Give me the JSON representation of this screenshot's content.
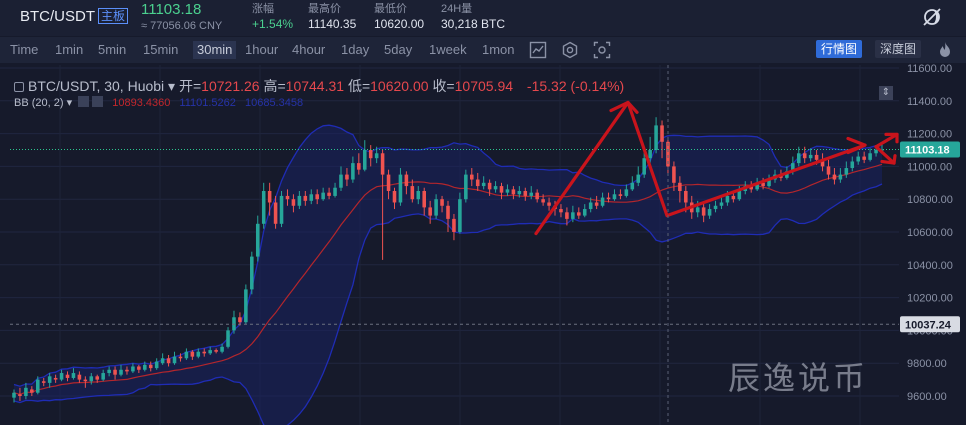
{
  "header": {
    "pair": "BTC/USDT",
    "main_tag": "主板",
    "price": "11103.18",
    "cny": "≈ 77056.06 CNY",
    "stats": [
      {
        "label": "涨幅",
        "value": "+1.54%",
        "up": true
      },
      {
        "label": "最高价",
        "value": "11140.35",
        "up": false
      },
      {
        "label": "最低价",
        "value": "10620.00",
        "up": false
      },
      {
        "label": "24H量",
        "value": "30,218 BTC",
        "up": false
      }
    ],
    "logo_icon": "moon-slash-icon"
  },
  "timeframes": {
    "items": [
      "Time",
      "1min",
      "5min",
      "15min",
      "30min",
      "1hour",
      "4hour",
      "1day",
      "5day",
      "1week",
      "1mon"
    ],
    "active": "30min"
  },
  "tools": {
    "icons": [
      "indicator-icon",
      "settings-hex-icon",
      "screenshot-icon"
    ],
    "views": [
      "行情图",
      "深度图"
    ],
    "active_view": "行情图",
    "flame_icon": "flame-icon"
  },
  "legend": {
    "title": "BTC/USDT, 30, Huobi",
    "open_label": "开=",
    "open": "10721.26",
    "high_label": "高=",
    "high": "10744.31",
    "low_label": "低=",
    "low": "10620.00",
    "close_label": "收=",
    "close": "10705.94",
    "change": "-15.32 (-0.14%)"
  },
  "bb": {
    "label": "BB (20, 2)",
    "mid": "10893.4360",
    "upper": "11101.5262",
    "lower": "10685.3458"
  },
  "axis": {
    "ticks": [
      "11600.00",
      "11400.00",
      "11200.00",
      "11000.00",
      "10800.00",
      "10600.00",
      "10400.00",
      "10200.00",
      "10000.00",
      "9800.00",
      "9600.00"
    ],
    "current_price": "11103.18",
    "marker_price": "10037.24"
  },
  "watermark": "辰逸说币",
  "colors": {
    "up": "#26a69a",
    "down": "#ef5350",
    "accent": "#2f6bd8",
    "band_upper": "#1f2cb5",
    "band_mid": "#b3262c",
    "arrow": "#c9141c"
  },
  "chart_data": {
    "type": "candlestick",
    "y_range": [
      9520,
      11700
    ],
    "candles": [
      [
        9590,
        9620,
        9560,
        9640
      ],
      [
        9610,
        9600,
        9570,
        9650
      ],
      [
        9600,
        9650,
        9580,
        9680
      ],
      [
        9640,
        9620,
        9600,
        9660
      ],
      [
        9620,
        9700,
        9610,
        9720
      ],
      [
        9690,
        9680,
        9660,
        9710
      ],
      [
        9680,
        9720,
        9650,
        9740
      ],
      [
        9710,
        9700,
        9680,
        9730
      ],
      [
        9700,
        9740,
        9690,
        9760
      ],
      [
        9730,
        9710,
        9690,
        9750
      ],
      [
        9710,
        9740,
        9700,
        9770
      ],
      [
        9730,
        9700,
        9680,
        9750
      ],
      [
        9700,
        9690,
        9650,
        9720
      ],
      [
        9690,
        9720,
        9670,
        9740
      ],
      [
        9720,
        9700,
        9680,
        9730
      ],
      [
        9700,
        9740,
        9690,
        9760
      ],
      [
        9740,
        9760,
        9720,
        9780
      ],
      [
        9760,
        9730,
        9700,
        9780
      ],
      [
        9730,
        9760,
        9720,
        9790
      ],
      [
        9760,
        9750,
        9730,
        9780
      ],
      [
        9750,
        9780,
        9740,
        9800
      ],
      [
        9780,
        9760,
        9740,
        9790
      ],
      [
        9760,
        9790,
        9750,
        9810
      ],
      [
        9790,
        9770,
        9750,
        9810
      ],
      [
        9770,
        9810,
        9760,
        9830
      ],
      [
        9800,
        9830,
        9790,
        9860
      ],
      [
        9830,
        9800,
        9780,
        9850
      ],
      [
        9800,
        9840,
        9790,
        9870
      ],
      [
        9840,
        9830,
        9810,
        9860
      ],
      [
        9830,
        9870,
        9820,
        9890
      ],
      [
        9870,
        9840,
        9820,
        9880
      ],
      [
        9840,
        9870,
        9830,
        9890
      ],
      [
        9870,
        9860,
        9840,
        9890
      ],
      [
        9860,
        9880,
        9850,
        9900
      ],
      [
        9880,
        9870,
        9860,
        9890
      ],
      [
        9870,
        9900,
        9860,
        9920
      ],
      [
        9900,
        10000,
        9890,
        10020
      ],
      [
        10000,
        10080,
        9980,
        10120
      ],
      [
        10080,
        10050,
        10030,
        10110
      ],
      [
        10050,
        10250,
        10040,
        10280
      ],
      [
        10250,
        10450,
        10220,
        10480
      ],
      [
        10450,
        10650,
        10420,
        10700
      ],
      [
        10650,
        10850,
        10620,
        10900
      ],
      [
        10850,
        10780,
        10700,
        10900
      ],
      [
        10780,
        10650,
        10620,
        10820
      ],
      [
        10650,
        10820,
        10630,
        10850
      ],
      [
        10820,
        10800,
        10760,
        10860
      ],
      [
        10800,
        10760,
        10720,
        10830
      ],
      [
        10760,
        10820,
        10740,
        10850
      ],
      [
        10820,
        10790,
        10760,
        10850
      ],
      [
        10790,
        10830,
        10770,
        10860
      ],
      [
        10830,
        10800,
        10770,
        10860
      ],
      [
        10800,
        10840,
        10790,
        10870
      ],
      [
        10840,
        10820,
        10800,
        10870
      ],
      [
        10820,
        10870,
        10810,
        10900
      ],
      [
        10870,
        10950,
        10850,
        11000
      ],
      [
        10950,
        10920,
        10880,
        10990
      ],
      [
        10920,
        11020,
        10900,
        11060
      ],
      [
        11020,
        10980,
        10950,
        11080
      ],
      [
        10980,
        11100,
        10970,
        11160
      ],
      [
        11100,
        11050,
        11000,
        11130
      ],
      [
        11050,
        11080,
        11020,
        11120
      ],
      [
        11080,
        10950,
        10430,
        11100
      ],
      [
        10950,
        10850,
        10800,
        10980
      ],
      [
        10850,
        10780,
        10740,
        10870
      ],
      [
        10780,
        10950,
        10760,
        10990
      ],
      [
        10950,
        10880,
        10830,
        10970
      ],
      [
        10880,
        10800,
        10780,
        10920
      ],
      [
        10800,
        10850,
        10770,
        10880
      ],
      [
        10850,
        10750,
        10700,
        10870
      ],
      [
        10750,
        10700,
        10650,
        10790
      ],
      [
        10700,
        10800,
        10680,
        10830
      ],
      [
        10800,
        10760,
        10720,
        10820
      ],
      [
        10760,
        10680,
        10600,
        10790
      ],
      [
        10680,
        10600,
        10550,
        10710
      ],
      [
        10600,
        10800,
        10590,
        10840
      ],
      [
        10800,
        10950,
        10780,
        10980
      ],
      [
        10950,
        10920,
        10880,
        10990
      ],
      [
        10920,
        10880,
        10850,
        10960
      ],
      [
        10880,
        10900,
        10860,
        10940
      ],
      [
        10900,
        10860,
        10820,
        10920
      ],
      [
        10860,
        10880,
        10840,
        10910
      ],
      [
        10880,
        10840,
        10800,
        10900
      ],
      [
        10840,
        10860,
        10820,
        10890
      ],
      [
        10860,
        10830,
        10800,
        10880
      ],
      [
        10830,
        10850,
        10810,
        10880
      ],
      [
        10850,
        10820,
        10790,
        10870
      ],
      [
        10820,
        10840,
        10800,
        10880
      ],
      [
        10840,
        10800,
        10780,
        10860
      ],
      [
        10800,
        10780,
        10760,
        10830
      ],
      [
        10780,
        10760,
        10730,
        10810
      ],
      [
        10760,
        10740,
        10700,
        10790
      ],
      [
        10740,
        10720,
        10690,
        10770
      ],
      [
        10720,
        10680,
        10640,
        10750
      ],
      [
        10680,
        10720,
        10660,
        10760
      ],
      [
        10720,
        10700,
        10680,
        10750
      ],
      [
        10700,
        10740,
        10690,
        10770
      ],
      [
        10740,
        10780,
        10720,
        10810
      ],
      [
        10780,
        10760,
        10740,
        10820
      ],
      [
        10760,
        10810,
        10750,
        10840
      ],
      [
        10810,
        10800,
        10780,
        10840
      ],
      [
        10800,
        10830,
        10790,
        10860
      ],
      [
        10830,
        10820,
        10800,
        10860
      ],
      [
        10820,
        10860,
        10810,
        10890
      ],
      [
        10860,
        10900,
        10850,
        10940
      ],
      [
        10900,
        10950,
        10880,
        11000
      ],
      [
        10950,
        11050,
        10930,
        11100
      ],
      [
        11050,
        11100,
        11020,
        11180
      ],
      [
        11100,
        11250,
        11080,
        11300
      ],
      [
        11250,
        11150,
        11050,
        11280
      ],
      [
        11150,
        11000,
        10950,
        11180
      ],
      [
        11000,
        10900,
        10850,
        11030
      ],
      [
        10900,
        10850,
        10780,
        10940
      ],
      [
        10850,
        10780,
        10720,
        10880
      ],
      [
        10780,
        10720,
        10680,
        10820
      ],
      [
        10720,
        10750,
        10690,
        10790
      ],
      [
        10750,
        10700,
        10660,
        10780
      ],
      [
        10700,
        10740,
        10680,
        10770
      ],
      [
        10740,
        10760,
        10720,
        10790
      ],
      [
        10760,
        10780,
        10740,
        10820
      ],
      [
        10780,
        10820,
        10760,
        10850
      ],
      [
        10820,
        10800,
        10780,
        10850
      ],
      [
        10800,
        10850,
        10790,
        10880
      ],
      [
        10850,
        10880,
        10830,
        10910
      ],
      [
        10880,
        10860,
        10840,
        10910
      ],
      [
        10860,
        10900,
        10850,
        10930
      ],
      [
        10900,
        10880,
        10860,
        10930
      ],
      [
        10880,
        10920,
        10870,
        10950
      ],
      [
        10920,
        10950,
        10900,
        10980
      ],
      [
        10950,
        10930,
        10910,
        10980
      ],
      [
        10930,
        10970,
        10920,
        11000
      ],
      [
        10970,
        11020,
        10950,
        11060
      ],
      [
        11020,
        11080,
        11000,
        11120
      ],
      [
        11080,
        11050,
        11020,
        11120
      ],
      [
        11050,
        11070,
        11030,
        11110
      ],
      [
        11070,
        11040,
        11010,
        11100
      ],
      [
        11040,
        11000,
        10970,
        11080
      ],
      [
        11000,
        10950,
        10920,
        11040
      ],
      [
        10950,
        10920,
        10890,
        10990
      ],
      [
        10920,
        10950,
        10900,
        10990
      ],
      [
        10950,
        10990,
        10930,
        11030
      ],
      [
        10990,
        11030,
        10970,
        11060
      ],
      [
        11030,
        11060,
        11010,
        11090
      ],
      [
        11060,
        11040,
        11020,
        11090
      ],
      [
        11040,
        11080,
        11030,
        11110
      ],
      [
        11080,
        11100,
        11060,
        11130
      ],
      [
        11100,
        11103,
        11080,
        11140
      ]
    ]
  }
}
